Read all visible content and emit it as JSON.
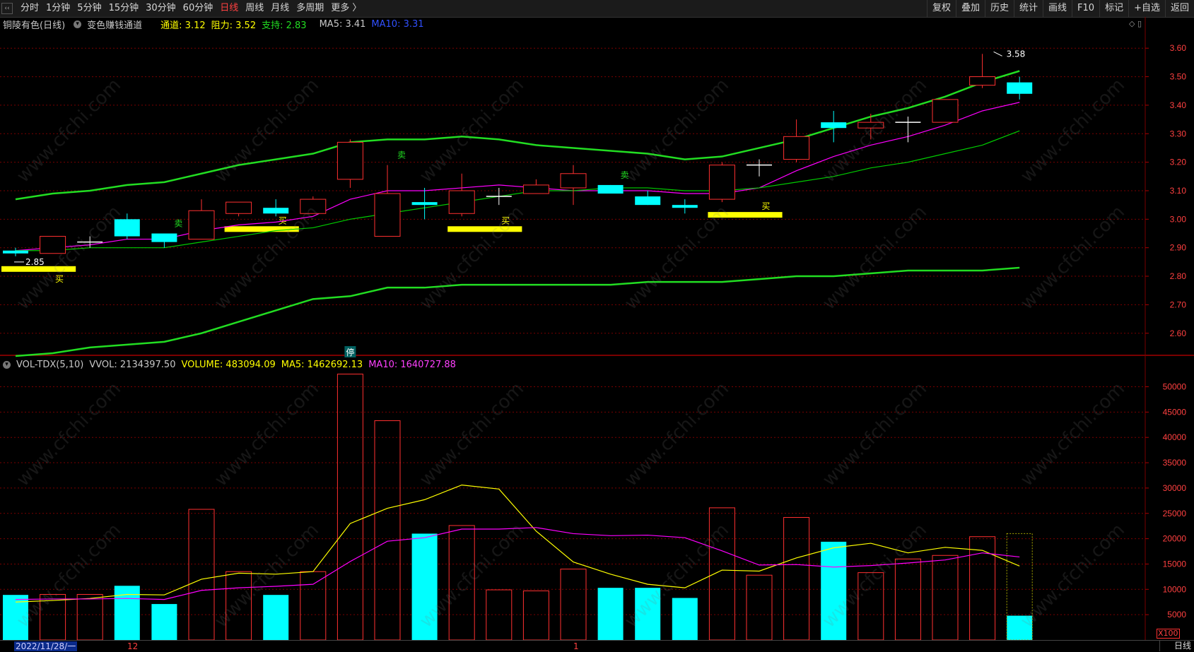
{
  "toolbar": {
    "timeframes": [
      "分时",
      "1分钟",
      "5分钟",
      "15分钟",
      "30分钟",
      "60分钟",
      "日线",
      "周线",
      "月线",
      "多周期",
      "更多 〉"
    ],
    "active": "日线",
    "right_buttons": [
      "复权",
      "叠加",
      "历史",
      "统计",
      "画线",
      "F10",
      "标记",
      "+自选",
      "返回"
    ]
  },
  "price_panel": {
    "stock": "铜陵有色(日线)",
    "indicator": "变色赚钱通道",
    "channel_label": "通道: 3.12",
    "resist_label": "阻力: 3.52",
    "support_label": "支持: 2.83",
    "ma5_label": "MA5: 3.41",
    "ma10_label": "MA10: 3.31",
    "high_label": "3.58",
    "low_label": "2.85",
    "halt_marker": "停",
    "buy_text": "买",
    "sell_text": "卖"
  },
  "volume_panel": {
    "indicator": "VOL-TDX(5,10)",
    "vvol_label": "VVOL: 2134397.50",
    "volume_label": "VOLUME: 483094.09",
    "ma5_label": "MA5: 1462692.13",
    "ma10_label": "MA10: 1640727.88",
    "unit_badge": "X100"
  },
  "statusbar": {
    "date": "2022/11/28/一",
    "month1": "12",
    "month2": "1",
    "period": "日线"
  },
  "watermark": "www.cfchi.com",
  "colors": {
    "up": "#ff3030",
    "down": "#00ffff",
    "channel": "#22dd22",
    "ma_mid": "#ff00ff",
    "ma_slow": "#00cc00",
    "vol_ma5": "#ffff00",
    "vol_ma10": "#ff00ff",
    "buy_band": "#ffff00",
    "grid": "#7a0000"
  },
  "chart_data": {
    "type": "candlestick",
    "price_axis": {
      "ticks": [
        "3.60",
        "3.50",
        "3.40",
        "3.30",
        "3.20",
        "3.10",
        "3.00",
        "2.90",
        "2.80",
        "2.70",
        "2.60"
      ],
      "ylim": [
        2.53,
        3.66
      ]
    },
    "volume_axis": {
      "ticks": [
        "50000",
        "45000",
        "40000",
        "35000",
        "30000",
        "25000",
        "20000",
        "15000",
        "10000",
        "5000"
      ],
      "ylim": [
        0,
        53000
      ]
    },
    "candles": [
      {
        "o": 2.89,
        "h": 2.9,
        "l": 2.87,
        "c": 2.88,
        "v": 8900
      },
      {
        "o": 2.88,
        "h": 2.94,
        "l": 2.88,
        "c": 2.94,
        "v": 9000
      },
      {
        "o": 2.92,
        "h": 2.94,
        "l": 2.9,
        "c": 2.92,
        "v": 9000
      },
      {
        "o": 3.0,
        "h": 3.02,
        "l": 2.93,
        "c": 2.94,
        "v": 10700
      },
      {
        "o": 2.95,
        "h": 2.95,
        "l": 2.9,
        "c": 2.92,
        "v": 7100
      },
      {
        "o": 2.93,
        "h": 3.07,
        "l": 2.93,
        "c": 3.03,
        "v": 25800
      },
      {
        "o": 3.02,
        "h": 3.06,
        "l": 3.01,
        "c": 3.06,
        "v": 13500
      },
      {
        "o": 3.04,
        "h": 3.07,
        "l": 3.01,
        "c": 3.02,
        "v": 8900
      },
      {
        "o": 3.02,
        "h": 3.08,
        "l": 3.02,
        "c": 3.07,
        "v": 13500
      },
      {
        "o": 3.14,
        "h": 3.28,
        "l": 3.11,
        "c": 3.27,
        "v": 52500
      },
      {
        "o": 2.94,
        "h": 3.19,
        "l": 2.94,
        "c": 3.09,
        "v": 43300
      },
      {
        "o": 3.06,
        "h": 3.11,
        "l": 3.0,
        "c": 3.05,
        "v": 21000
      },
      {
        "o": 3.02,
        "h": 3.16,
        "l": 3.01,
        "c": 3.1,
        "v": 22600
      },
      {
        "o": 3.08,
        "h": 3.11,
        "l": 3.05,
        "c": 3.08,
        "v": 9900
      },
      {
        "o": 3.09,
        "h": 3.14,
        "l": 3.09,
        "c": 3.12,
        "v": 9700
      },
      {
        "o": 3.11,
        "h": 3.19,
        "l": 3.05,
        "c": 3.16,
        "v": 14000
      },
      {
        "o": 3.12,
        "h": 3.12,
        "l": 3.09,
        "c": 3.09,
        "v": 10300
      },
      {
        "o": 3.08,
        "h": 3.1,
        "l": 3.05,
        "c": 3.05,
        "v": 10300
      },
      {
        "o": 3.05,
        "h": 3.07,
        "l": 3.02,
        "c": 3.04,
        "v": 8300
      },
      {
        "o": 3.07,
        "h": 3.2,
        "l": 3.06,
        "c": 3.19,
        "v": 26100
      },
      {
        "o": 3.19,
        "h": 3.21,
        "l": 3.15,
        "c": 3.19,
        "v": 12800
      },
      {
        "o": 3.21,
        "h": 3.35,
        "l": 3.2,
        "c": 3.29,
        "v": 24200
      },
      {
        "o": 3.34,
        "h": 3.38,
        "l": 3.27,
        "c": 3.32,
        "v": 19400
      },
      {
        "o": 3.32,
        "h": 3.37,
        "l": 3.28,
        "c": 3.34,
        "v": 13300
      },
      {
        "o": 3.34,
        "h": 3.36,
        "l": 3.27,
        "c": 3.34,
        "v": 16000
      },
      {
        "o": 3.34,
        "h": 3.42,
        "l": 3.34,
        "c": 3.42,
        "v": 16700
      },
      {
        "o": 3.47,
        "h": 3.58,
        "l": 3.46,
        "c": 3.5,
        "v": 20400
      },
      {
        "o": 3.48,
        "h": 3.5,
        "l": 3.42,
        "c": 3.44,
        "v": 4800
      }
    ],
    "series": [
      {
        "name": "上轨",
        "values": [
          3.07,
          3.09,
          3.1,
          3.12,
          3.13,
          3.16,
          3.19,
          3.21,
          3.23,
          3.27,
          3.28,
          3.28,
          3.29,
          3.28,
          3.26,
          3.25,
          3.24,
          3.23,
          3.21,
          3.22,
          3.25,
          3.28,
          3.32,
          3.36,
          3.39,
          3.43,
          3.48,
          3.52
        ]
      },
      {
        "name": "下轨",
        "values": [
          2.52,
          2.53,
          2.55,
          2.56,
          2.57,
          2.6,
          2.64,
          2.68,
          2.72,
          2.73,
          2.76,
          2.76,
          2.77,
          2.77,
          2.77,
          2.77,
          2.77,
          2.78,
          2.78,
          2.78,
          2.79,
          2.8,
          2.8,
          2.81,
          2.82,
          2.82,
          2.82,
          2.83
        ]
      },
      {
        "name": "中线",
        "values": [
          2.89,
          2.9,
          2.91,
          2.93,
          2.93,
          2.96,
          2.98,
          2.99,
          3.01,
          3.07,
          3.1,
          3.1,
          3.11,
          3.12,
          3.11,
          3.1,
          3.1,
          3.1,
          3.09,
          3.09,
          3.11,
          3.17,
          3.22,
          3.26,
          3.29,
          3.33,
          3.38,
          3.41
        ]
      },
      {
        "name": "慢线",
        "values": [
          2.89,
          2.89,
          2.9,
          2.9,
          2.9,
          2.92,
          2.94,
          2.96,
          2.97,
          3.0,
          3.02,
          3.04,
          3.06,
          3.08,
          3.1,
          3.1,
          3.11,
          3.11,
          3.1,
          3.1,
          3.11,
          3.13,
          3.15,
          3.18,
          3.2,
          3.23,
          3.26,
          3.31
        ]
      },
      {
        "name": "VMA5",
        "values": [
          7500,
          7800,
          8200,
          9000,
          8900,
          12000,
          13200,
          13000,
          13500,
          23000,
          26000,
          27700,
          30600,
          29800,
          21500,
          15400,
          13000,
          11000,
          10300,
          13800,
          13600,
          16200,
          18200,
          19100,
          17200,
          18300,
          17700,
          14600
        ]
      },
      {
        "name": "VMA10",
        "values": [
          8000,
          8100,
          8100,
          8200,
          8000,
          9800,
          10300,
          10600,
          11000,
          15500,
          19500,
          20200,
          21900,
          21900,
          22200,
          21000,
          20600,
          20700,
          20200,
          17600,
          14800,
          14900,
          14400,
          14700,
          15200,
          15800,
          17200,
          16400
        ]
      }
    ],
    "buy_points": [
      0,
      6,
      12,
      19
    ],
    "sell_points": [
      4,
      10,
      16
    ]
  }
}
